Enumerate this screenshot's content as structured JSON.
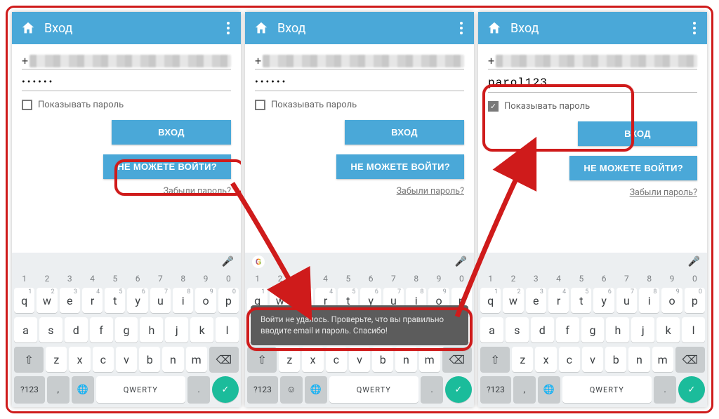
{
  "appbar": {
    "title": "Вход"
  },
  "fields": {
    "phone_prefix": "+",
    "password_masked": "••••••",
    "password_plain": "parol123"
  },
  "checkbox": {
    "label": "Показывать пароль"
  },
  "buttons": {
    "login": "ВХОД",
    "cant_login": "НЕ МОЖЕТЕ ВОЙТИ?"
  },
  "links": {
    "forgot": "Забыли пароль?"
  },
  "toast": {
    "message": "Войти не удалось. Проверьте, что вы правильно вводите email и пароль. Спасибо!"
  },
  "keyboard": {
    "numbers": [
      "1",
      "2",
      "3",
      "4",
      "5",
      "6",
      "7",
      "8",
      "9",
      "0"
    ],
    "row1": [
      "q",
      "w",
      "e",
      "r",
      "t",
      "y",
      "u",
      "i",
      "o",
      "p"
    ],
    "row2": [
      "a",
      "s",
      "d",
      "f",
      "g",
      "h",
      "j",
      "k",
      "l"
    ],
    "row3": [
      "z",
      "x",
      "c",
      "v",
      "b",
      "n",
      "m"
    ],
    "space_label": "QWERTY",
    "sym_label": "?123",
    "comma": ",",
    "period": ".",
    "shift_icon": "⇧",
    "backspace_icon": "⌫",
    "globe_icon": "🌐",
    "smiley_icon": "☺",
    "enter_icon": "✓",
    "mic_icon": "🎤"
  },
  "hints": {
    "q": "1",
    "w": "2",
    "e": "3",
    "r": "4",
    "t": "5",
    "y": "6",
    "u": "7",
    "i": "8",
    "o": "9",
    "p": "0"
  }
}
